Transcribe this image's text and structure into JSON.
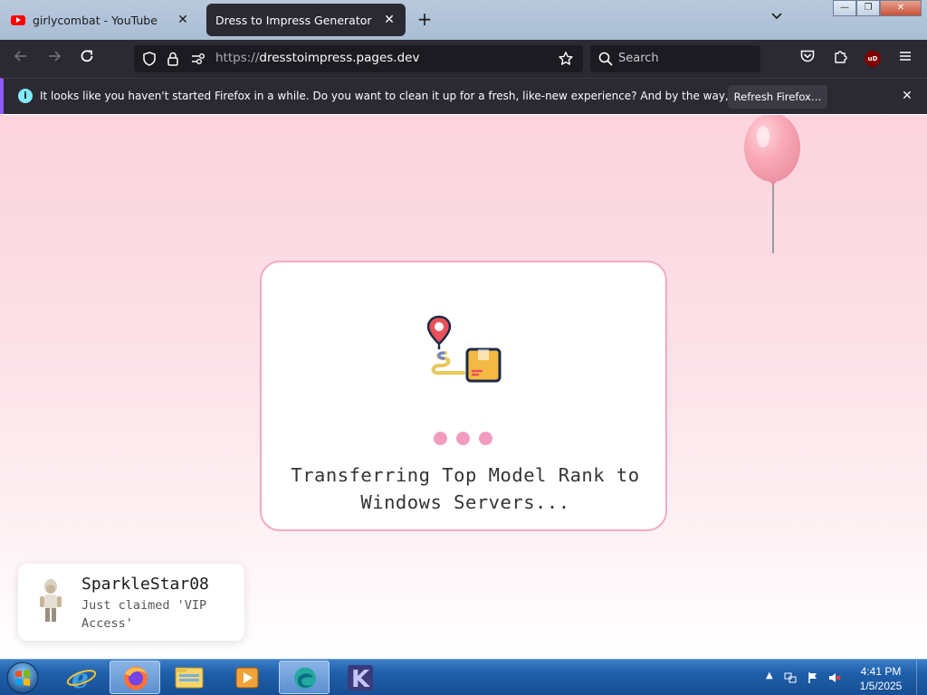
{
  "browser": {
    "tabs": [
      {
        "label": "girlycombat - YouTube",
        "close": "✕"
      },
      {
        "label": "Dress to Impress Generator",
        "close": "✕"
      }
    ],
    "new_tab": "+",
    "tab_list": "⌄",
    "window_controls": {
      "minimize": "—",
      "maximize": "❐",
      "close": "✕"
    },
    "url": {
      "protocol": "https://",
      "host": "dresstoimpress.pages.dev"
    },
    "search_placeholder": "Search",
    "extension_badge": "uD"
  },
  "notification": {
    "text": "It looks like you haven't started Firefox in a while. Do you want to clean it up for a fresh, like-new experience? And by the way, welcome back!",
    "button": "Refresh Firefox…",
    "info_glyph": "i",
    "close": "✕"
  },
  "page": {
    "loader_text": "Transferring Top Model Rank to Windows Servers...",
    "dot_color": "#f29cc0",
    "card_border_color": "#f4a8c3",
    "toast": {
      "username": "SparkleStar08",
      "message": "Just claimed 'VIP Access'"
    }
  },
  "taskbar": {
    "time": "4:41 PM",
    "date": "1/5/2025",
    "tray_arrow": "▲",
    "pinned": [
      "internet-explorer-icon",
      "firefox-icon",
      "file-explorer-icon",
      "media-player-icon",
      "edge-like-icon",
      "k-app-icon"
    ]
  }
}
